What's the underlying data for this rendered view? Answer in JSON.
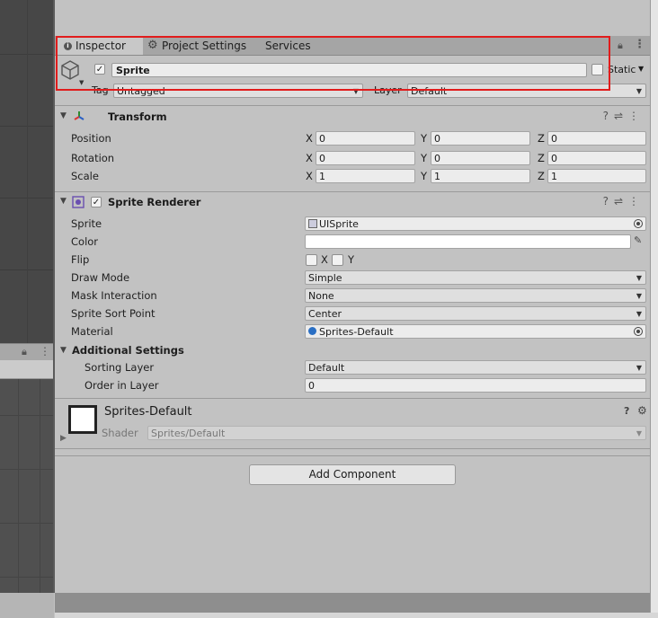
{
  "tabs": [
    {
      "label": "Inspector",
      "icon": "info-icon"
    },
    {
      "label": "Project Settings",
      "icon": "gear-icon"
    },
    {
      "label": "Services"
    }
  ],
  "gameobject": {
    "active": true,
    "name": "Sprite",
    "static_label": "Static",
    "tag_label": "Tag",
    "tag_value": "Untagged",
    "layer_label": "Layer",
    "layer_value": "Default"
  },
  "transform": {
    "title": "Transform",
    "rows": [
      {
        "label": "Position",
        "x": "0",
        "y": "0",
        "z": "0"
      },
      {
        "label": "Rotation",
        "x": "0",
        "y": "0",
        "z": "0"
      },
      {
        "label": "Scale",
        "x": "1",
        "y": "1",
        "z": "1"
      }
    ],
    "axes": [
      "X",
      "Y",
      "Z"
    ]
  },
  "sprite_renderer": {
    "title": "Sprite Renderer",
    "enabled": true,
    "sprite_label": "Sprite",
    "sprite_value": "UISprite",
    "color_label": "Color",
    "color_value": "#ffffff",
    "flip_label": "Flip",
    "flip_x_label": "X",
    "flip_y_label": "Y",
    "draw_mode_label": "Draw Mode",
    "draw_mode_value": "Simple",
    "mask_label": "Mask Interaction",
    "mask_value": "None",
    "sort_point_label": "Sprite Sort Point",
    "sort_point_value": "Center",
    "material_label": "Material",
    "material_value": "Sprites-Default",
    "additional_label": "Additional Settings",
    "sorting_layer_label": "Sorting Layer",
    "sorting_layer_value": "Default",
    "order_label": "Order in Layer",
    "order_value": "0"
  },
  "material": {
    "name": "Sprites-Default",
    "shader_label": "Shader",
    "shader_value": "Sprites/Default"
  },
  "add_component_label": "Add Component",
  "colors": {
    "highlight": "#e11c1c",
    "panel": "#c2c2c2",
    "active_tab": "#3a72b0"
  }
}
